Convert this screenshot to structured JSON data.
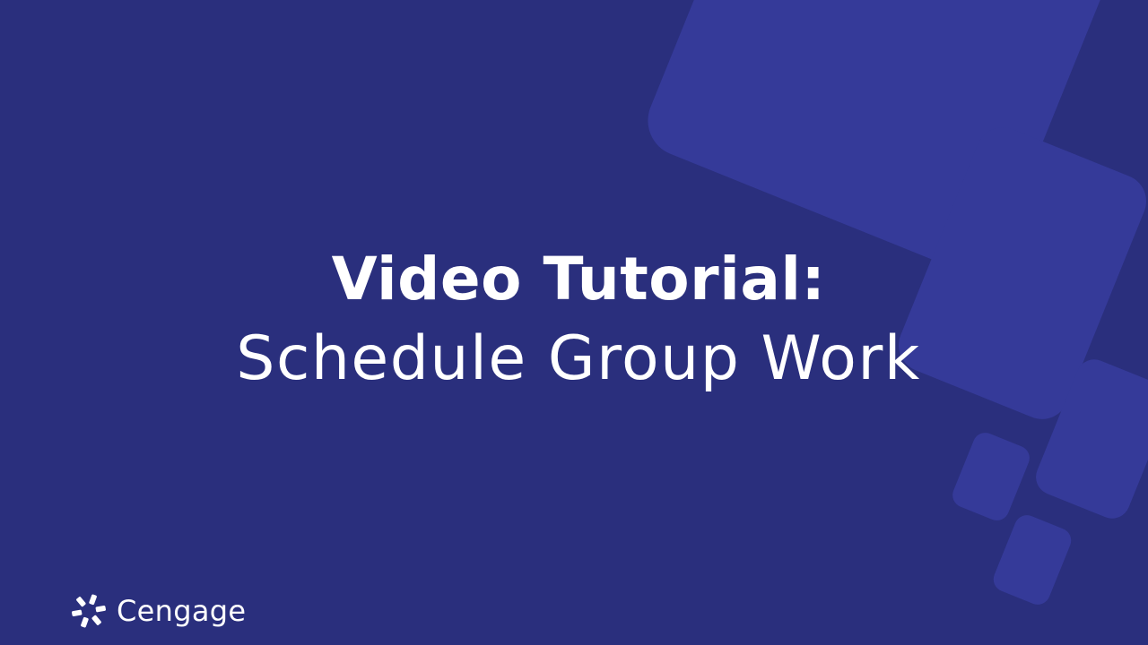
{
  "title": {
    "line1": "Video Tutorial:",
    "line2": "Schedule Group Work"
  },
  "brand": {
    "name": "Cengage",
    "icon": "cengage-logo-icon"
  },
  "colors": {
    "background": "#2a2f7d",
    "shape": "#353a99",
    "text": "#ffffff"
  }
}
